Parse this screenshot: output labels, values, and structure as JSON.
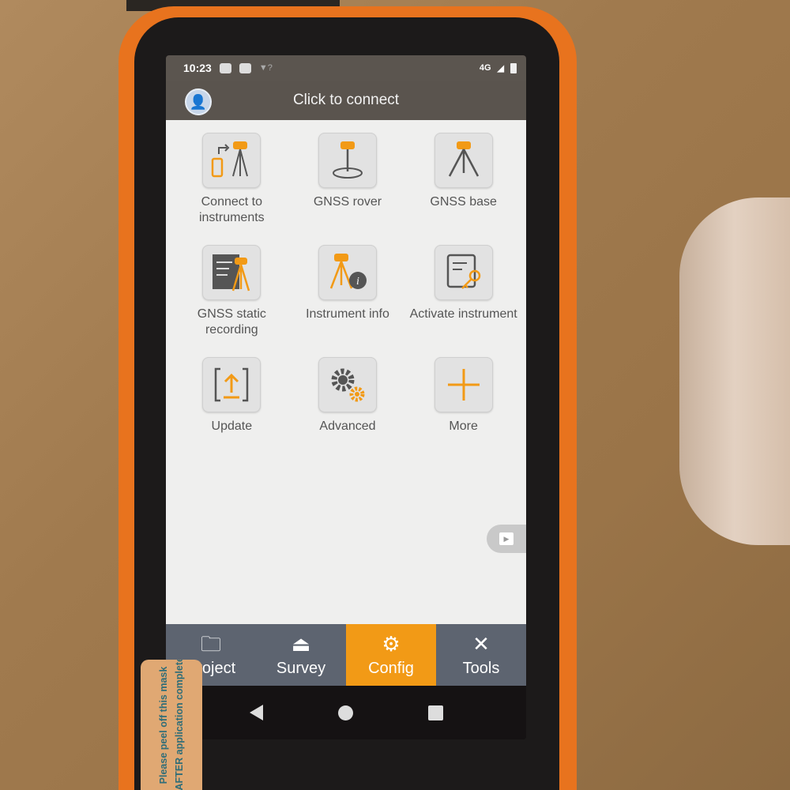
{
  "status_bar": {
    "time": "10:23",
    "network": "4G"
  },
  "header": {
    "title": "Click to connect"
  },
  "menu": [
    {
      "label": "Connect to instruments",
      "icon": "connect-instruments-icon"
    },
    {
      "label": "GNSS rover",
      "icon": "gnss-rover-icon"
    },
    {
      "label": "GNSS base",
      "icon": "gnss-base-icon"
    },
    {
      "label": "GNSS static recording",
      "icon": "static-recording-icon"
    },
    {
      "label": "Instrument info",
      "icon": "instrument-info-icon"
    },
    {
      "label": "Activate instrument",
      "icon": "activate-key-icon"
    },
    {
      "label": "Update",
      "icon": "update-icon"
    },
    {
      "label": "Advanced",
      "icon": "gears-icon"
    },
    {
      "label": "More",
      "icon": "plus-icon"
    }
  ],
  "tabs": [
    {
      "label": "Project",
      "icon": "folder-icon",
      "active": false
    },
    {
      "label": "Survey",
      "icon": "survey-icon",
      "active": false
    },
    {
      "label": "Config",
      "icon": "gear-icon",
      "active": true
    },
    {
      "label": "Tools",
      "icon": "tools-icon",
      "active": false
    }
  ],
  "sticker": {
    "line1": "Please peel off this mask",
    "line2": "AFTER application completed"
  },
  "colors": {
    "accent": "#f29a16",
    "tabbar": "#5d6470",
    "header": "#5a544e",
    "phone_body": "#e8731e"
  }
}
